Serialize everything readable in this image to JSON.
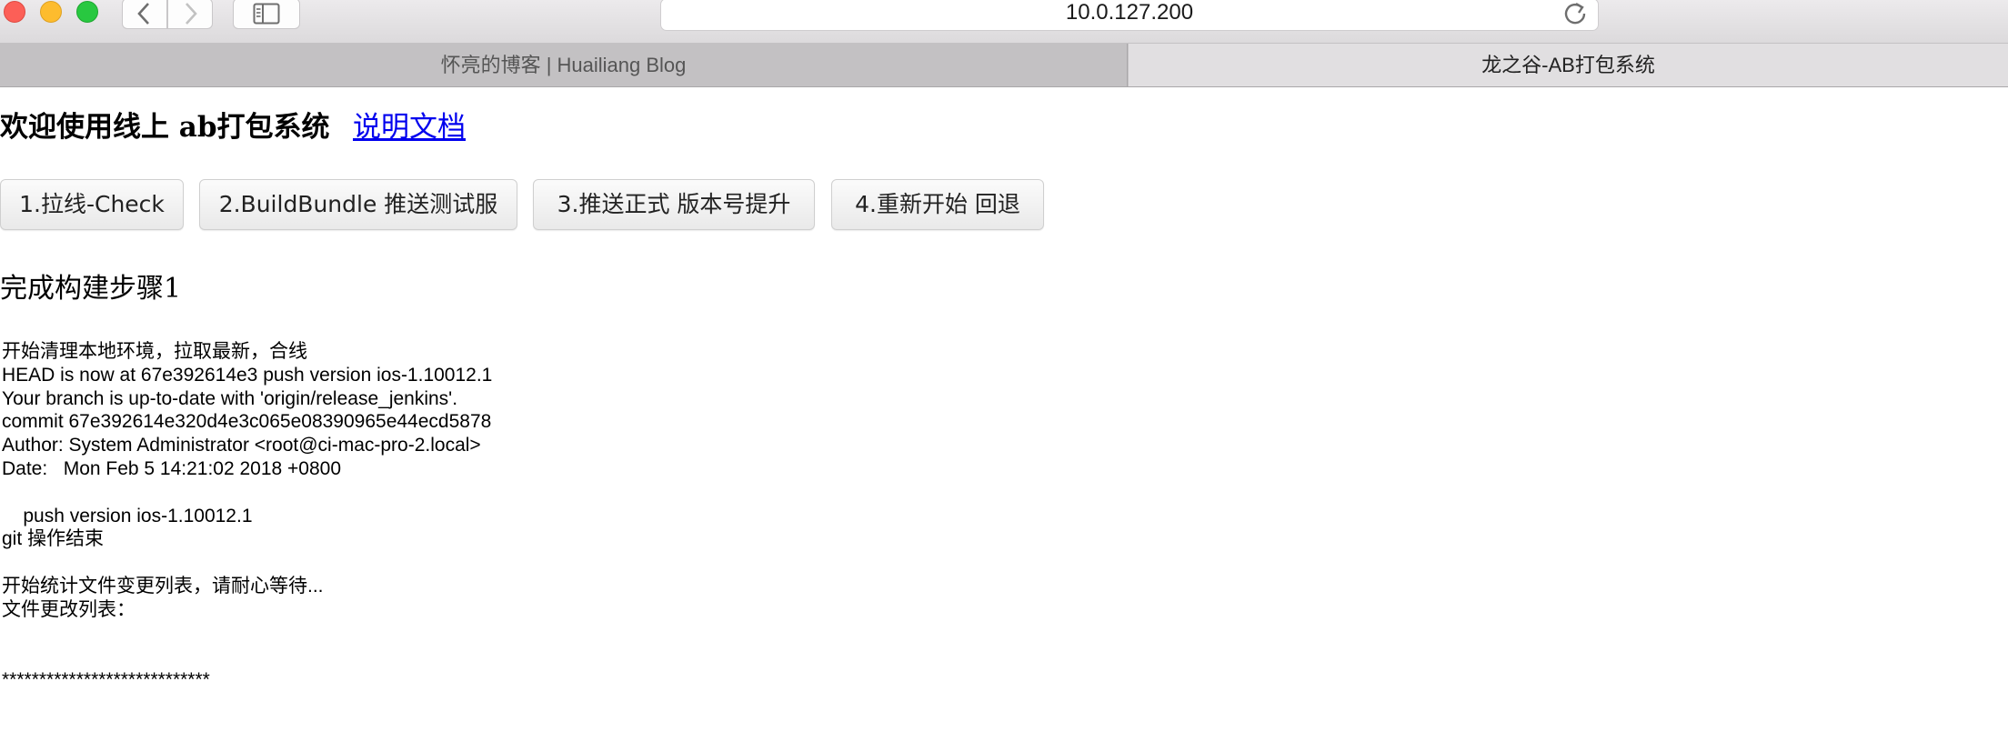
{
  "window": {
    "address": "10.0.127.200",
    "icons": {
      "back": "chevron-left-icon",
      "forward": "chevron-right-icon",
      "sidebar": "sidebar-icon",
      "reload": "reload-icon"
    },
    "traffic_colors": {
      "close": "#fc5f57",
      "minimize": "#fdbc2e",
      "zoom": "#28c840"
    }
  },
  "tabs": [
    {
      "label": "怀亮的博客 | Huailiang Blog"
    },
    {
      "label": "龙之谷-AB打包系统"
    }
  ],
  "page": {
    "welcome": "欢迎使用线上 ab打包系统",
    "doc_link": "说明文档",
    "buttons": [
      {
        "label": "1.拉线-Check"
      },
      {
        "label": "2.BuildBundle 推送测试服"
      },
      {
        "label": "3.推送正式 版本号提升"
      },
      {
        "label": "4.重新开始 回退"
      }
    ],
    "status": "完成构建步骤1",
    "log": [
      "开始清理本地环境，拉取最新，合线",
      "HEAD is now at 67e392614e3 push version ios-1.10012.1",
      "Your branch is up-to-date with 'origin/release_jenkins'.",
      "commit 67e392614e320d4e3c065e08390965e44ecd5878",
      "Author: System Administrator <root@ci-mac-pro-2.local>",
      "Date:   Mon Feb 5 14:21:02 2018 +0800",
      "",
      "    push version ios-1.10012.1",
      "git 操作结束",
      "",
      "开始统计文件变更列表，请耐心等待...",
      "文件更改列表：",
      "",
      "",
      "****************************"
    ],
    "link_color": "#0000ee"
  }
}
